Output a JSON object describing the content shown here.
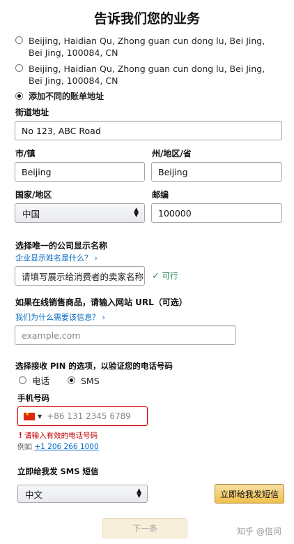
{
  "page": {
    "title": "告诉我们您的业务"
  },
  "billing": {
    "addresses": [
      "Beijing, Haidian Qu, Zhong guan cun dong lu, Bei Jing, Bei Jing, 100084, CN",
      "Beijing, Haidian Qu, Zhong guan cun dong lu, Bei Jing, Bei Jing, 100084, CN"
    ],
    "add_different_label": "添加不同的账单地址",
    "selected_index": 2
  },
  "address_form": {
    "street_label": "街道地址",
    "street_value": "No 123, ABC Road",
    "city_label": "市/镇",
    "city_value": "Beijing",
    "state_label": "州/地区/省",
    "state_value": "Beijing",
    "country_label": "国家/地区",
    "country_value": "中国",
    "postal_label": "邮编",
    "postal_value": "100000"
  },
  "display_name": {
    "label": "选择唯一的公司显示名称",
    "help_link": "企业显示姓名是什么？",
    "placeholder": "请填写展示给消费者的卖家名称",
    "status": "可行"
  },
  "website": {
    "label": "如果在线销售商品，请输入网站 URL（可选）",
    "help_link": "我们为什么需要该信息？",
    "placeholder": "example.com"
  },
  "pin": {
    "label": "选择接收 PIN 的选项，以验证您的电话号码",
    "options": [
      "电话",
      "SMS"
    ],
    "selected": "SMS"
  },
  "phone": {
    "label": "手机号码",
    "placeholder": "+86 131 2345 6789",
    "error": "请输入有效的电话号码",
    "example_prefix": "例如",
    "example_number": "+1 206 266 1000",
    "flag_icon": "china-flag-icon"
  },
  "sms": {
    "label": "立即给我发 SMS 短信",
    "language_value": "中文",
    "send_button": "立即给我发短信"
  },
  "footer": {
    "next_button": "下一条",
    "watermark": "知乎 @倍问"
  },
  "colors": {
    "link": "#0066c0",
    "error": "#c40000",
    "success": "#2e8b57",
    "button_yellow": "#f0c14b"
  }
}
